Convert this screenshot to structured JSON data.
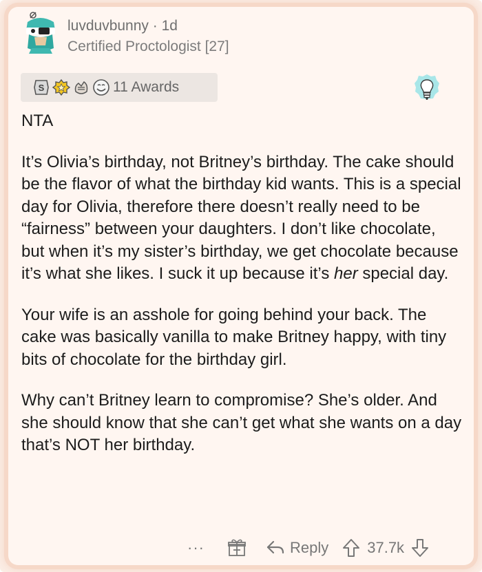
{
  "comment": {
    "author": "luvduvbunny",
    "separator": "·",
    "age": "1d",
    "username_line": "luvduvbunny · 1d",
    "flair": "Certified Proctologist [27]",
    "awards": {
      "icons": [
        "silver-award-icon",
        "helpful-award-icon",
        "bravo-award-icon",
        "wholesome-award-icon"
      ],
      "label": "11 Awards"
    },
    "paragraphs": {
      "p1": "NTA",
      "p2_main": "It’s Olivia’s birthday, not Britney’s birthday. The cake should be the flavor of what the birthday kid wants. This is a special day for Olivia, therefore there doesn’t really need to be “fairness” between your daughters. I don’t like chocolate, but when it’s my sister’s birthday, we get chocolate because it’s what she likes. I suck it up because it’s ",
      "p2_emph": "her",
      "p2_end": " special day.",
      "p3": "Your wife is an asshole for going behind your back. The cake was basically vanilla to make Britney happy, with tiny bits of chocolate for the birthday girl.",
      "p4": "Why can’t Britney learn to compromise? She’s older. And she should know that she can’t get what she wants on a day that’s NOT her birthday."
    },
    "actions": {
      "more": "···",
      "reply": "Reply",
      "score": "37.7k"
    }
  },
  "colors": {
    "card_background": "#fff6f1",
    "card_glow": "#f6d8c8",
    "text": "#1c1c1c",
    "meta_text": "#6f6f6f",
    "award_bar": "#ece6e2",
    "avatar_teal": "#3fb8b0"
  }
}
